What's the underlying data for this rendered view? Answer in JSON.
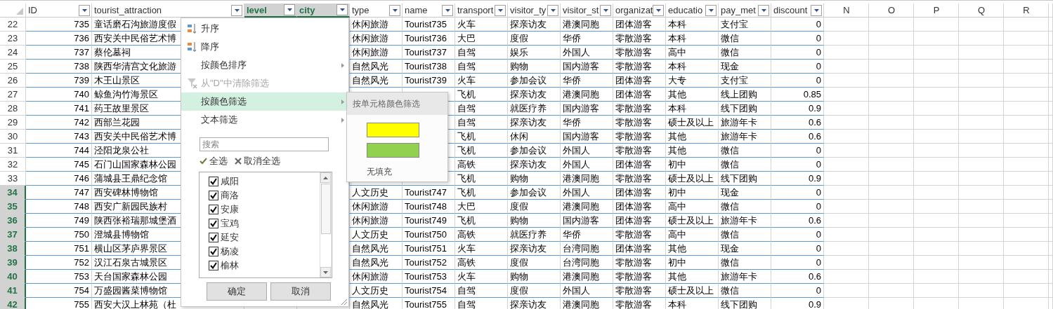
{
  "columns": [
    {
      "label": "ID",
      "kind": "filter",
      "selected": false
    },
    {
      "label": "tourist_attraction",
      "kind": "filter",
      "selected": false
    },
    {
      "label": "level",
      "kind": "filter",
      "selected": true
    },
    {
      "label": "city",
      "kind": "filter",
      "selected": true
    },
    {
      "label": "type",
      "kind": "filter",
      "selected": false
    },
    {
      "label": "name",
      "kind": "filter",
      "selected": false
    },
    {
      "label": "transport",
      "kind": "filter",
      "selected": false
    },
    {
      "label": "visitor_ty",
      "kind": "filter",
      "selected": false
    },
    {
      "label": "visitor_st",
      "kind": "filter",
      "selected": false
    },
    {
      "label": "organizat",
      "kind": "filter",
      "selected": false
    },
    {
      "label": "educatio",
      "kind": "filter",
      "selected": false
    },
    {
      "label": "pay_met",
      "kind": "filter",
      "selected": false
    },
    {
      "label": "discount",
      "kind": "filter",
      "selected": false
    },
    {
      "label": "N",
      "kind": "letter",
      "selected": false
    },
    {
      "label": "O",
      "kind": "letter",
      "selected": false
    },
    {
      "label": "P",
      "kind": "letter",
      "selected": false
    },
    {
      "label": "Q",
      "kind": "letter",
      "selected": false
    },
    {
      "label": "R",
      "kind": "letter",
      "selected": false
    }
  ],
  "rows": [
    {
      "number": "22",
      "selected": false,
      "id": "735",
      "attraction": "童话磨石沟旅游度假",
      "type": "休闲旅游",
      "name": "Tourist735",
      "transport": "火车",
      "visitor_type": "探亲访友",
      "visitor_status": "港澳同胞",
      "organization": "团体游客",
      "education": "本科",
      "pay_method": "支付宝",
      "discount": "0"
    },
    {
      "number": "23",
      "selected": false,
      "id": "736",
      "attraction": "西安关中民俗艺术博",
      "type": "休闲旅游",
      "name": "Tourist736",
      "transport": "大巴",
      "visitor_type": "度假",
      "visitor_status": "华侨",
      "organization": "零散游客",
      "education": "本科",
      "pay_method": "微信",
      "discount": "0"
    },
    {
      "number": "24",
      "selected": false,
      "id": "737",
      "attraction": "蔡伦墓祠",
      "type": "休闲旅游",
      "name": "Tourist737",
      "transport": "自驾",
      "visitor_type": "娱乐",
      "visitor_status": "外国人",
      "organization": "零散游客",
      "education": "高中",
      "pay_method": "微信",
      "discount": "0"
    },
    {
      "number": "25",
      "selected": false,
      "id": "738",
      "attraction": "陕西华清宫文化旅游",
      "type": "自然风光",
      "name": "Tourist738",
      "transport": "自驾",
      "visitor_type": "购物",
      "visitor_status": "国内游客",
      "organization": "零散游客",
      "education": "本科",
      "pay_method": "现金",
      "discount": "0"
    },
    {
      "number": "26",
      "selected": false,
      "id": "739",
      "attraction": "木王山景区",
      "type": "自然风光",
      "name": "Tourist739",
      "transport": "火车",
      "visitor_type": "参加会议",
      "visitor_status": "华侨",
      "organization": "团体游客",
      "education": "大专",
      "pay_method": "支付宝",
      "discount": "0"
    },
    {
      "number": "27",
      "selected": false,
      "id": "740",
      "attraction": "鲸鱼沟竹海景区",
      "transport": "飞机",
      "visitor_type": "探亲访友",
      "visitor_status": "港澳同胞",
      "organization": "团体游客",
      "education": "其他",
      "pay_method": "线上团购",
      "discount": "0.85"
    },
    {
      "number": "28",
      "selected": false,
      "id": "741",
      "attraction": "药王故里景区",
      "transport": "自驾",
      "visitor_type": "就医疗养",
      "visitor_status": "国内游客",
      "organization": "零散游客",
      "education": "本科",
      "pay_method": "线下团购",
      "discount": "0.9"
    },
    {
      "number": "29",
      "selected": false,
      "id": "742",
      "attraction": "西部兰花园",
      "transport": "自驾",
      "visitor_type": "探亲访友",
      "visitor_status": "华侨",
      "organization": "零散游客",
      "education": "硕士及以上",
      "pay_method": "旅游年卡",
      "discount": "0.6"
    },
    {
      "number": "30",
      "selected": false,
      "id": "743",
      "attraction": "西安关中民俗艺术博",
      "transport": "飞机",
      "visitor_type": "休闲",
      "visitor_status": "国内游客",
      "organization": "零散游客",
      "education": "其他",
      "pay_method": "旅游年卡",
      "discount": "0.6"
    },
    {
      "number": "31",
      "selected": false,
      "id": "744",
      "attraction": "泾阳龙泉公社",
      "transport": "飞机",
      "visitor_type": "参加会议",
      "visitor_status": "外国人",
      "organization": "零散游客",
      "education": "其他",
      "pay_method": "微信",
      "discount": "0"
    },
    {
      "number": "32",
      "selected": false,
      "id": "745",
      "attraction": "石门山国家森林公园",
      "transport": "高铁",
      "visitor_type": "探亲访友",
      "visitor_status": "外国人",
      "organization": "团体游客",
      "education": "初中",
      "pay_method": "微信",
      "discount": "0"
    },
    {
      "number": "33",
      "selected": false,
      "id": "746",
      "attraction": "蒲城县王鼎纪念馆",
      "transport": "飞机",
      "visitor_type": "购物",
      "visitor_status": "港澳同胞",
      "organization": "零散游客",
      "education": "硕士及以上",
      "pay_method": "线下团购",
      "discount": "0.9"
    },
    {
      "number": "34",
      "selected": true,
      "id": "747",
      "attraction": "西安碑林博物馆",
      "type": "人文历史",
      "name": "Tourist747",
      "transport": "飞机",
      "visitor_type": "参加会议",
      "visitor_status": "外国人",
      "organization": "团体游客",
      "education": "初中",
      "pay_method": "现金",
      "discount": "0"
    },
    {
      "number": "35",
      "selected": true,
      "id": "748",
      "attraction": "西安广新园民族村",
      "type": "休闲旅游",
      "name": "Tourist748",
      "transport": "大巴",
      "visitor_type": "度假",
      "visitor_status": "港澳同胞",
      "organization": "团体游客",
      "education": "高中",
      "pay_method": "微信",
      "discount": "0"
    },
    {
      "number": "36",
      "selected": true,
      "id": "749",
      "attraction": "陕西张裕瑞那城堡酒",
      "type": "休闲旅游",
      "name": "Tourist749",
      "transport": "飞机",
      "visitor_type": "购物",
      "visitor_status": "国内游客",
      "organization": "团体游客",
      "education": "硕士及以上",
      "pay_method": "旅游年卡",
      "discount": "0.6"
    },
    {
      "number": "37",
      "selected": true,
      "id": "750",
      "attraction": "澄城县博物馆",
      "type": "人文历史",
      "name": "Tourist750",
      "transport": "高铁",
      "visitor_type": "就医疗养",
      "visitor_status": "华侨",
      "organization": "零散游客",
      "education": "高中",
      "pay_method": "微信",
      "discount": "0"
    },
    {
      "number": "38",
      "selected": true,
      "id": "751",
      "attraction": "横山区茅庐界景区",
      "type": "自然风光",
      "name": "Tourist751",
      "transport": "火车",
      "visitor_type": "探亲访友",
      "visitor_status": "台湾同胞",
      "organization": "团体游客",
      "education": "其他",
      "pay_method": "现金",
      "discount": "0"
    },
    {
      "number": "39",
      "selected": true,
      "id": "752",
      "attraction": "汉江石泉古城景区",
      "type": "自然风光",
      "name": "Tourist752",
      "transport": "高铁",
      "visitor_type": "度假",
      "visitor_status": "台湾同胞",
      "organization": "零散游客",
      "education": "初中",
      "pay_method": "微信",
      "discount": "0"
    },
    {
      "number": "40",
      "selected": true,
      "id": "753",
      "attraction": "天台国家森林公园",
      "type": "休闲旅游",
      "name": "Tourist753",
      "transport": "火车",
      "visitor_type": "购物",
      "visitor_status": "港澳同胞",
      "organization": "零散游客",
      "education": "其他",
      "pay_method": "旅游年卡",
      "discount": "0.6"
    },
    {
      "number": "41",
      "selected": true,
      "id": "754",
      "attraction": "万盛园酱菜博物馆",
      "type": "人文历史",
      "name": "Tourist754",
      "transport": "自驾",
      "visitor_type": "度假",
      "visitor_status": "外国人",
      "organization": "零散游客",
      "education": "硕士及以上",
      "pay_method": "微信",
      "discount": "0"
    },
    {
      "number": "42",
      "selected": true,
      "id": "755",
      "attraction": "西安大汉上林苑（杜",
      "type": "自然风光",
      "name": "Tourist755",
      "transport": "自驾",
      "visitor_type": "探亲访友",
      "visitor_status": "港澳同胞",
      "organization": "零散游客",
      "education": "本科",
      "pay_method": "线下团购",
      "discount": "0.9"
    }
  ],
  "filter_menu": {
    "items": [
      {
        "label": "升序",
        "kind": "ascending",
        "disabled": false,
        "selected": false
      },
      {
        "label": "降序",
        "kind": "descending",
        "disabled": false,
        "selected": false
      },
      {
        "label": "按颜色排序",
        "kind": "submenu",
        "disabled": false,
        "selected": false
      },
      {
        "label": "从\"D\"中清除筛选",
        "kind": "clear",
        "disabled": true,
        "selected": false
      },
      {
        "label": "按颜色筛选",
        "kind": "submenu",
        "disabled": false,
        "selected": true
      },
      {
        "label": "文本筛选",
        "kind": "submenu",
        "disabled": false,
        "selected": false
      }
    ],
    "search": {
      "placeholder": "搜索"
    },
    "select_all": "全选",
    "clear_all": "取消全选",
    "values": [
      {
        "label": "咸阳",
        "checked": true
      },
      {
        "label": "商洛",
        "checked": true
      },
      {
        "label": "安康",
        "checked": true
      },
      {
        "label": "宝鸡",
        "checked": true
      },
      {
        "label": "延安",
        "checked": true
      },
      {
        "label": "杨凌",
        "checked": true
      },
      {
        "label": "榆林",
        "checked": true
      }
    ],
    "buttons": [
      "确定",
      "取消"
    ]
  },
  "color_submenu": {
    "title": "按单元格颜色筛选",
    "swatches": [
      {
        "color": "#ffff00"
      },
      {
        "color": "#92d050"
      }
    ],
    "no_fill": "无填充"
  }
}
